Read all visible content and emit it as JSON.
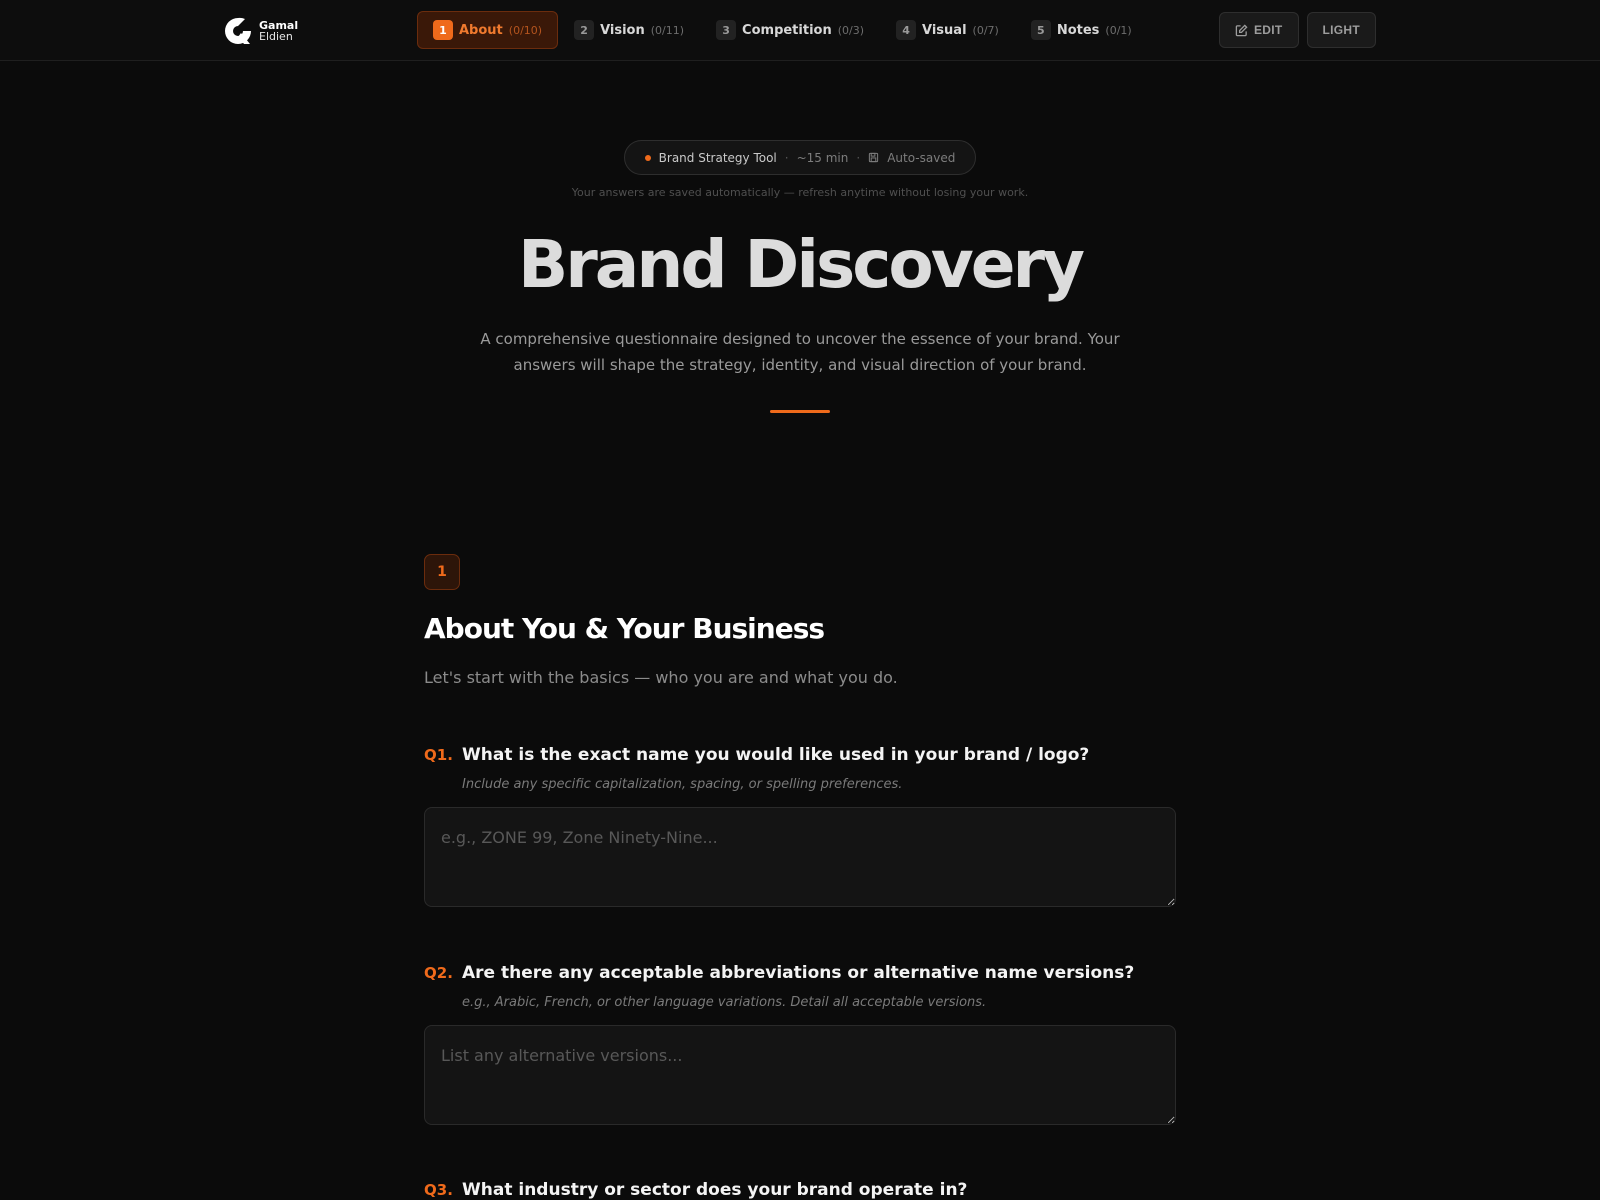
{
  "brand": {
    "line1": "Gamal",
    "line2": "Eldien"
  },
  "steps": [
    {
      "num": "1",
      "label": "About",
      "count": "(0/10)",
      "active": true
    },
    {
      "num": "2",
      "label": "Vision",
      "count": "(0/11)",
      "active": false
    },
    {
      "num": "3",
      "label": "Competition",
      "count": "(0/3)",
      "active": false
    },
    {
      "num": "4",
      "label": "Visual",
      "count": "(0/7)",
      "active": false
    },
    {
      "num": "5",
      "label": "Notes",
      "count": "(0/1)",
      "active": false
    }
  ],
  "header_buttons": {
    "edit": "EDIT",
    "theme": "LIGHT"
  },
  "pill": {
    "tool": "Brand Strategy Tool",
    "sep": "·",
    "time": "~15 min",
    "saved": "Auto-saved"
  },
  "saved_note": "Your answers are saved automatically — refresh anytime without losing your work.",
  "hero": {
    "title": "Brand Discovery",
    "description": "A comprehensive questionnaire designed to uncover the essence of your brand. Your answers will shape the strategy, identity, and visual direction of your brand."
  },
  "section": {
    "number": "1",
    "title": "About You & Your Business",
    "subtitle": "Let's start with the basics — who you are and what you do."
  },
  "questions": [
    {
      "num": "Q1.",
      "text": "What is the exact name you would like used in your brand / logo?",
      "hint": "Include any specific capitalization, spacing, or spelling preferences.",
      "placeholder": "e.g., ZONE 99, Zone Ninety-Nine...",
      "value": ""
    },
    {
      "num": "Q2.",
      "text": "Are there any acceptable abbreviations or alternative name versions?",
      "hint": "e.g., Arabic, French, or other language variations. Detail all acceptable versions.",
      "placeholder": "List any alternative versions...",
      "value": ""
    },
    {
      "num": "Q3.",
      "text": "What industry or sector does your brand operate in?"
    }
  ],
  "colors": {
    "accent": "#ef6a1b",
    "background": "#0b0b0b"
  }
}
